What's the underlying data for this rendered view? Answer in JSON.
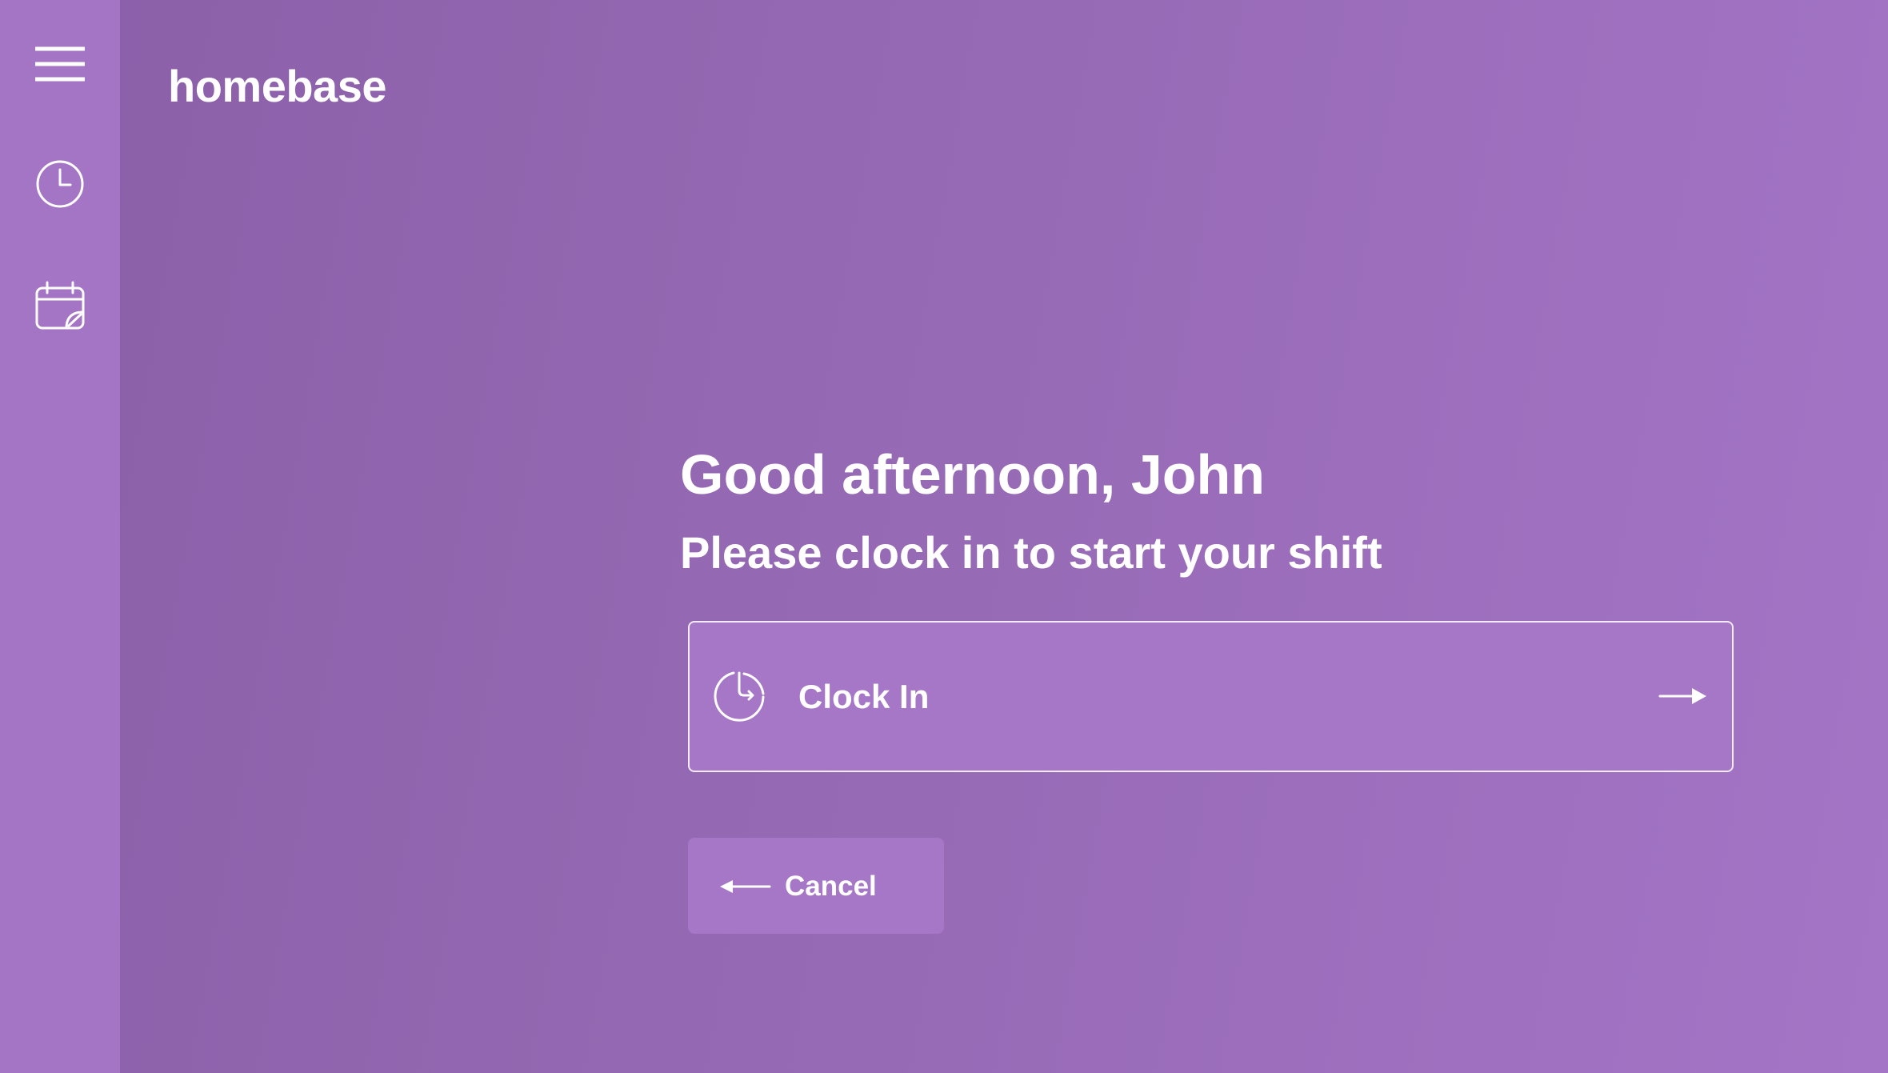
{
  "app": {
    "brand": "homebase"
  },
  "sidebar": {
    "items": [
      {
        "icon": "hamburger-menu-icon"
      },
      {
        "icon": "clock-icon"
      },
      {
        "icon": "calendar-note-icon"
      }
    ]
  },
  "main": {
    "greeting": "Good afternoon, John",
    "subtitle": "Please clock in to start your shift",
    "clock_in": {
      "label": "Clock In",
      "icon": "clock-in-icon",
      "trailing_icon": "arrow-right-icon"
    },
    "cancel": {
      "label": "Cancel",
      "icon": "arrow-left-icon"
    }
  },
  "colors": {
    "sidebar": "#a575c5",
    "background_start": "#8a5fa8",
    "background_end": "#a474c6",
    "button": "#a677c7",
    "text": "#ffffff"
  }
}
